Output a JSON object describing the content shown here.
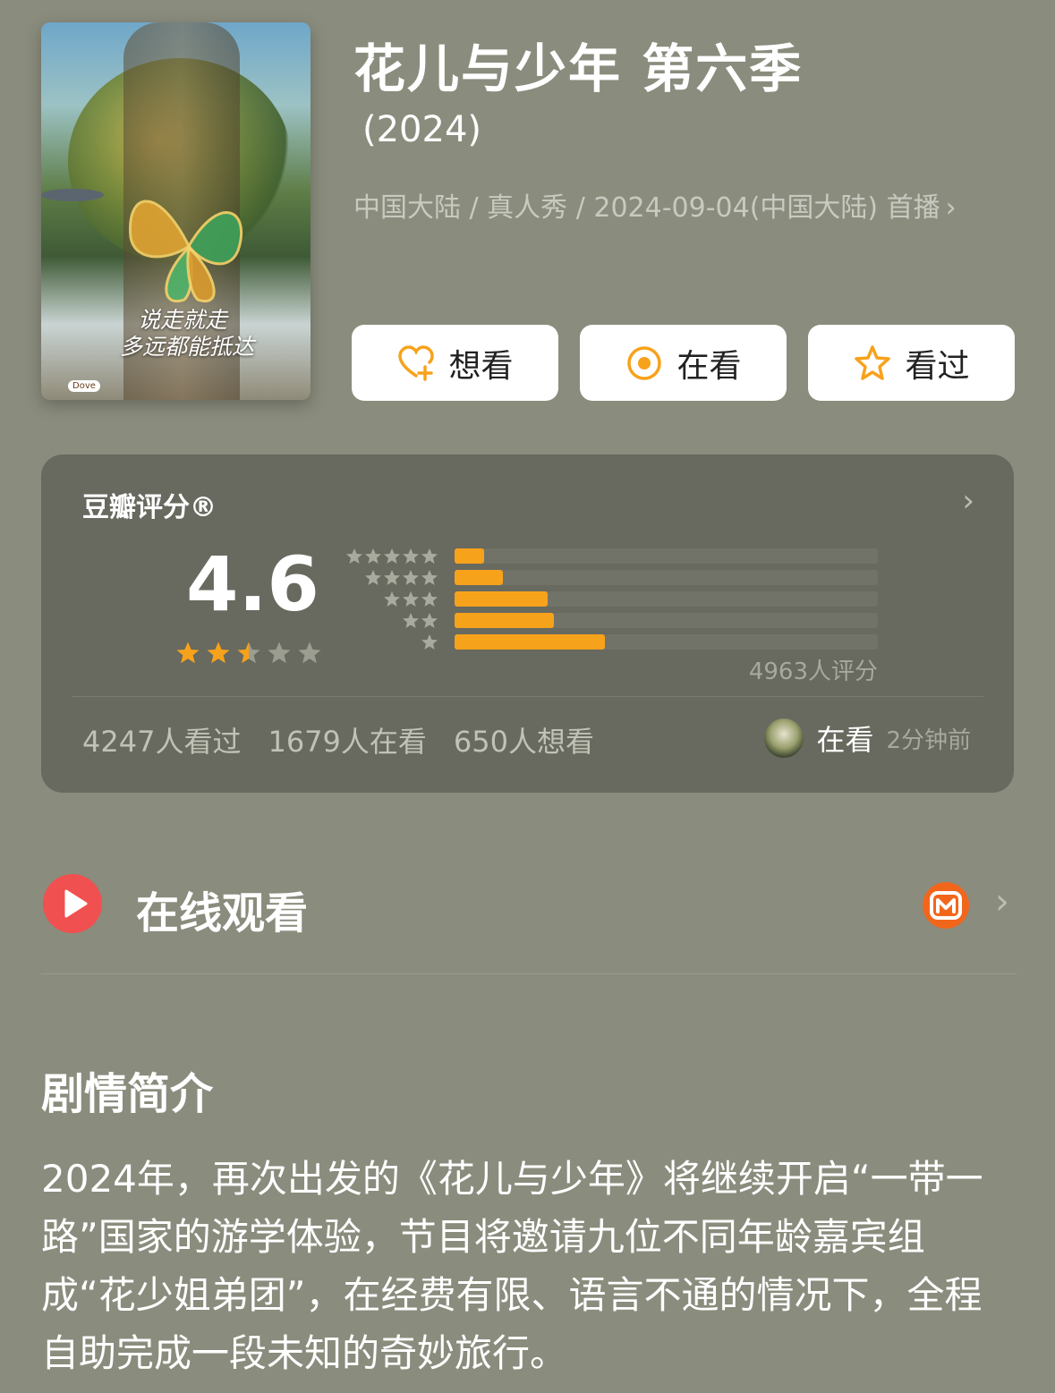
{
  "header": {
    "title": "花儿与少年 第六季",
    "year": "(2024)",
    "meta": "中国大陆 / 真人秀 / 2024-09-04(中国大陆) 首播",
    "meta_chevron": "›"
  },
  "poster": {
    "tagline_line1": "说走就走",
    "tagline_line2": "多远都能抵达",
    "brand": "Dove"
  },
  "actions": [
    {
      "label": "想看",
      "icon": "heart-plus-icon",
      "color": "#f7a21b"
    },
    {
      "label": "在看",
      "icon": "target-circle-icon",
      "color": "#f7a21b"
    },
    {
      "label": "看过",
      "icon": "star-outline-icon",
      "color": "#f7a21b"
    }
  ],
  "rating": {
    "label": "豆瓣评分®",
    "score": "4.6",
    "stars": 2.5,
    "count_text": "4963人评分",
    "distribution": [
      {
        "stars": 5,
        "fraction": 0.07
      },
      {
        "stars": 4,
        "fraction": 0.115
      },
      {
        "stars": 3,
        "fraction": 0.22
      },
      {
        "stars": 2,
        "fraction": 0.235
      },
      {
        "stars": 1,
        "fraction": 0.355
      }
    ],
    "stats": {
      "watched": "4247人看过",
      "watching": "1679人在看",
      "want": "650人想看"
    },
    "recent": {
      "status": "在看",
      "time": "2分钟前"
    },
    "chevron": "›"
  },
  "watch": {
    "label": "在线观看",
    "chevron": "›",
    "play_color": "#f0504f",
    "provider_color": "#f2661c"
  },
  "synopsis": {
    "title": "剧情简介",
    "text": "2024年，再次出发的《花儿与少年》将继续开启“一带一路”国家的游学体验，节目将邀请九位不同年龄嘉宾组成“花少姐弟团”，在经费有限、语言不通的情况下，全程自助完成一段未知的奇妙旅行。"
  },
  "colors": {
    "background": "#8a8c7d",
    "card": "#68695f",
    "accent": "#f7a21b"
  }
}
